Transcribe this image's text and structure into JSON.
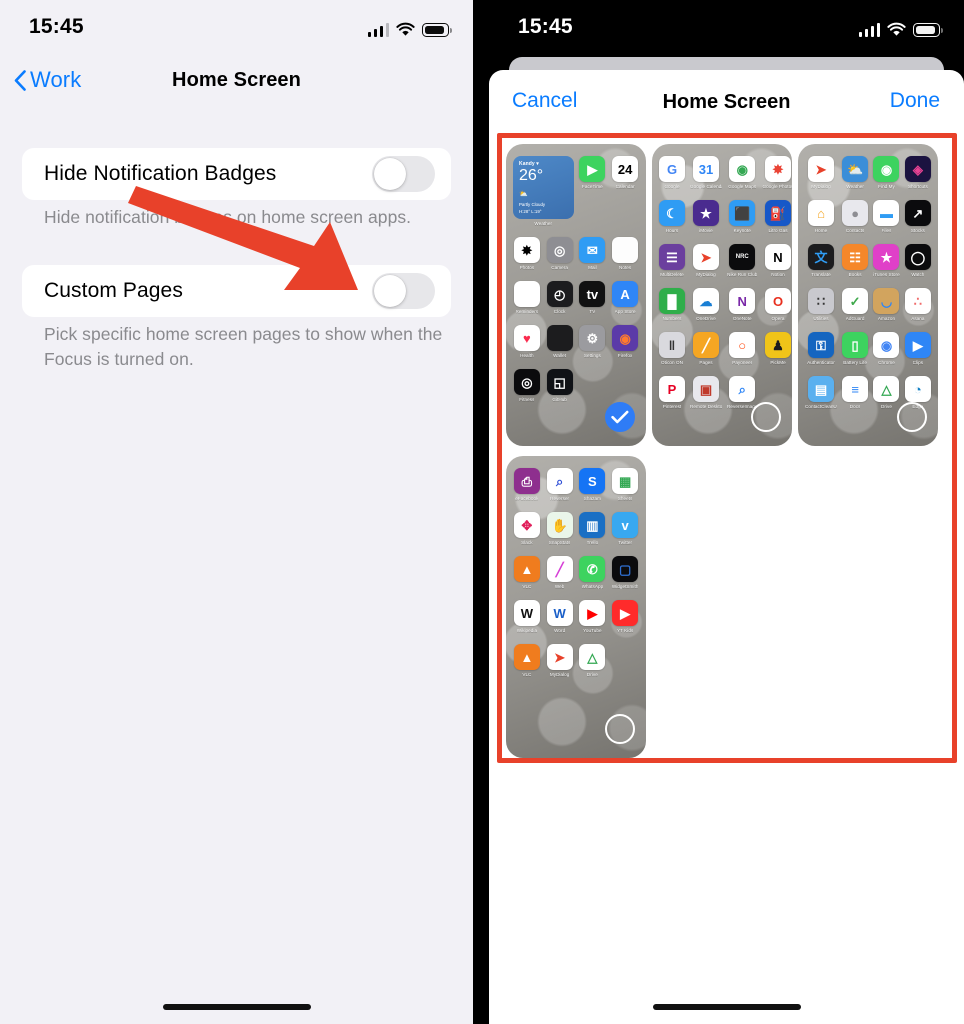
{
  "left": {
    "status": {
      "time": "15:45",
      "signal_icon": "cellular-bars-icon",
      "wifi_icon": "wifi-icon",
      "battery_icon": "battery-icon"
    },
    "nav": {
      "back_label": "Work",
      "back_icon": "chevron-left-icon",
      "title": "Home Screen"
    },
    "rows": [
      {
        "label": "Hide Notification Badges",
        "toggle_state": "off",
        "footnote": "Hide notification badges on home screen apps."
      },
      {
        "label": "Custom Pages",
        "toggle_state": "off",
        "footnote": "Pick specific home screen pages to show when the Focus is turned on."
      }
    ],
    "annotation": {
      "type": "arrow",
      "color": "#e8412a",
      "points_to": "custom-pages-toggle"
    }
  },
  "right": {
    "status": {
      "time": "15:45",
      "signal_icon": "cellular-bars-icon",
      "wifi_icon": "wifi-icon",
      "battery_icon": "battery-icon"
    },
    "sheet": {
      "cancel_label": "Cancel",
      "title": "Home Screen",
      "done_label": "Done"
    },
    "annotation": {
      "type": "rectangle",
      "color": "#e8412a"
    },
    "accent_color": "#0a7cff",
    "pages": [
      {
        "selected": true,
        "widget": {
          "city": "Kandy",
          "temp": "26°",
          "condition": "Partly Cloudy",
          "high_low": "H:28° L:19°",
          "caption": "Weather"
        },
        "apps": [
          {
            "name": "FaceTime",
            "icon": "facetime-icon",
            "bg": "#3dd35f",
            "fg": "#ffffff",
            "glyph": "▶"
          },
          {
            "name": "Calendar",
            "icon": "calendar-icon",
            "bg": "#ffffff",
            "fg": "#000000",
            "glyph": "24"
          },
          {
            "name": "Photos",
            "icon": "photos-icon",
            "bg": "#ffffff",
            "fg": "#000000",
            "glyph": "✸"
          },
          {
            "name": "Camera",
            "icon": "camera-icon",
            "bg": "#8e8e93",
            "fg": "#ffffff",
            "glyph": "◎"
          },
          {
            "name": "Mail",
            "icon": "mail-icon",
            "bg": "#2f9cf4",
            "fg": "#ffffff",
            "glyph": "✉"
          },
          {
            "name": "Notes",
            "icon": "notes-icon",
            "bg": "#fdfdfd",
            "fg": "#f0c419",
            "glyph": ""
          },
          {
            "name": "Reminders",
            "icon": "reminders-icon",
            "bg": "#ffffff",
            "fg": "#000000",
            "glyph": ""
          },
          {
            "name": "Clock",
            "icon": "clock-icon",
            "bg": "#1c1c1e",
            "fg": "#ffffff",
            "glyph": "◴"
          },
          {
            "name": "TV",
            "icon": "appletv-icon",
            "bg": "#111111",
            "fg": "#ffffff",
            "glyph": "tv"
          },
          {
            "name": "App Store",
            "icon": "appstore-icon",
            "bg": "#2f86f6",
            "fg": "#ffffff",
            "glyph": "A"
          },
          {
            "name": "Health",
            "icon": "health-icon",
            "bg": "#ffffff",
            "fg": "#fa2b4e",
            "glyph": "♥"
          },
          {
            "name": "Wallet",
            "icon": "wallet-icon",
            "bg": "#1c1c1e",
            "fg": "#ffffff",
            "glyph": ""
          },
          {
            "name": "Settings",
            "icon": "settings-icon",
            "bg": "#9b9b9f",
            "fg": "#ffffff",
            "glyph": "⚙"
          },
          {
            "name": "Firefox",
            "icon": "firefox-icon",
            "bg": "#5b3aa8",
            "fg": "#ff7a2f",
            "glyph": "◉"
          },
          {
            "name": "Fitness",
            "icon": "fitness-icon",
            "bg": "#0b0b0d",
            "fg": "#ffffff",
            "glyph": "◎"
          },
          {
            "name": "GitHub",
            "icon": "github-icon",
            "bg": "#101216",
            "fg": "#ffffff",
            "glyph": "◱"
          }
        ]
      },
      {
        "selected": false,
        "apps": [
          {
            "name": "Google",
            "icon": "google-icon",
            "bg": "#ffffff",
            "fg": "#4285f4",
            "glyph": "G"
          },
          {
            "name": "Google Calendar",
            "icon": "google-calendar-icon",
            "bg": "#ffffff",
            "fg": "#2f86f6",
            "glyph": "31"
          },
          {
            "name": "Google Maps",
            "icon": "google-maps-icon",
            "bg": "#ffffff",
            "fg": "#34a853",
            "glyph": "◉"
          },
          {
            "name": "Google Photos",
            "icon": "google-photos-icon",
            "bg": "#ffffff",
            "fg": "#ea4335",
            "glyph": "✸"
          },
          {
            "name": "Hours",
            "icon": "hours-icon",
            "bg": "#2f9cf4",
            "fg": "#ffffff",
            "glyph": "☾"
          },
          {
            "name": "iMovie",
            "icon": "imovie-icon",
            "bg": "#4a2b8f",
            "fg": "#ffffff",
            "glyph": "★"
          },
          {
            "name": "Keynote",
            "icon": "keynote-icon",
            "bg": "#2f9cf4",
            "fg": "#ffffff",
            "glyph": "⬛"
          },
          {
            "name": "Litro Gas",
            "icon": "litro-gas-icon",
            "bg": "#1758c8",
            "fg": "#ffffff",
            "glyph": "⛽"
          },
          {
            "name": "MultiDelete",
            "icon": "multidelete-icon",
            "bg": "#6b3f9e",
            "fg": "#ffffff",
            "glyph": "☰"
          },
          {
            "name": "MyDialog",
            "icon": "mydialog-icon",
            "bg": "#ffffff",
            "fg": "#e8412a",
            "glyph": "➤"
          },
          {
            "name": "Nike Run Club",
            "icon": "nike-run-club-icon",
            "bg": "#0b0b0d",
            "fg": "#ffffff",
            "glyph": "NRC"
          },
          {
            "name": "Notion",
            "icon": "notion-icon",
            "bg": "#ffffff",
            "fg": "#000000",
            "glyph": "N"
          },
          {
            "name": "Numbers",
            "icon": "numbers-icon",
            "bg": "#2fae4a",
            "fg": "#ffffff",
            "glyph": "█"
          },
          {
            "name": "OneDrive",
            "icon": "onedrive-icon",
            "bg": "#ffffff",
            "fg": "#1a7fd4",
            "glyph": "☁"
          },
          {
            "name": "OneNote",
            "icon": "onenote-icon",
            "bg": "#ffffff",
            "fg": "#7a29a8",
            "glyph": "N"
          },
          {
            "name": "Opera",
            "icon": "opera-icon",
            "bg": "#ffffff",
            "fg": "#e8301f",
            "glyph": "O"
          },
          {
            "name": "Oticon ON",
            "icon": "oticon-on-icon",
            "bg": "#d9d9de",
            "fg": "#333333",
            "glyph": "‖"
          },
          {
            "name": "Pages",
            "icon": "pages-icon",
            "bg": "#f5a623",
            "fg": "#ffffff",
            "glyph": "╱"
          },
          {
            "name": "Payoneer",
            "icon": "payoneer-icon",
            "bg": "#ffffff",
            "fg": "#ff4b12",
            "glyph": "○"
          },
          {
            "name": "PickMe",
            "icon": "pickme-icon",
            "bg": "#f0c419",
            "fg": "#1c1c1e",
            "glyph": "♟"
          },
          {
            "name": "Pinterest",
            "icon": "pinterest-icon",
            "bg": "#ffffff",
            "fg": "#e60023",
            "glyph": "P"
          },
          {
            "name": "Remote Desktop",
            "icon": "remote-desktop-icon",
            "bg": "#e8e8ed",
            "fg": "#c0392b",
            "glyph": "▣"
          },
          {
            "name": "ReverseImage",
            "icon": "reverse-image-icon",
            "bg": "#ffffff",
            "fg": "#2f86f6",
            "glyph": "⌕"
          }
        ]
      },
      {
        "selected": false,
        "apps": [
          {
            "name": "MyDialog",
            "icon": "mydialog-icon",
            "bg": "#ffffff",
            "fg": "#e8412a",
            "glyph": "➤"
          },
          {
            "name": "Weather",
            "icon": "weather-icon",
            "bg": "#3b8ed8",
            "fg": "#ffffff",
            "glyph": "⛅"
          },
          {
            "name": "Find My",
            "icon": "find-my-icon",
            "bg": "#3dd35f",
            "fg": "#ffffff",
            "glyph": "◉"
          },
          {
            "name": "Shortcuts",
            "icon": "shortcuts-icon",
            "bg": "#1b1340",
            "fg": "#e84393",
            "glyph": "◈"
          },
          {
            "name": "Home",
            "icon": "home-icon",
            "bg": "#ffffff",
            "fg": "#f5a623",
            "glyph": "⌂"
          },
          {
            "name": "Contacts",
            "icon": "contacts-icon",
            "bg": "#e8e8ed",
            "fg": "#8e8e93",
            "glyph": "●"
          },
          {
            "name": "Files",
            "icon": "files-icon",
            "bg": "#ffffff",
            "fg": "#2f9cf4",
            "glyph": "▬"
          },
          {
            "name": "Stocks",
            "icon": "stocks-icon",
            "bg": "#0b0b0d",
            "fg": "#ffffff",
            "glyph": "↗"
          },
          {
            "name": "Translate",
            "icon": "translate-icon",
            "bg": "#1c1c1e",
            "fg": "#2f9cf4",
            "glyph": "文"
          },
          {
            "name": "Books",
            "icon": "books-icon",
            "bg": "#f5872a",
            "fg": "#ffffff",
            "glyph": "☷"
          },
          {
            "name": "iTunes Store",
            "icon": "itunes-store-icon",
            "bg": "#e040c8",
            "fg": "#ffffff",
            "glyph": "★"
          },
          {
            "name": "Watch",
            "icon": "watch-icon",
            "bg": "#0b0b0d",
            "fg": "#ffffff",
            "glyph": "◯"
          },
          {
            "name": "Utilities",
            "icon": "utilities-folder-icon",
            "bg": "#c9c9ce",
            "fg": "#333333",
            "glyph": "∷"
          },
          {
            "name": "AdGuard",
            "icon": "adguard-icon",
            "bg": "#ffffff",
            "fg": "#3fa94c",
            "glyph": "✓"
          },
          {
            "name": "Amazon",
            "icon": "amazon-icon",
            "bg": "#d2a45e",
            "fg": "#2f86f6",
            "glyph": "◡"
          },
          {
            "name": "Asana",
            "icon": "asana-icon",
            "bg": "#ffffff",
            "fg": "#f06a6a",
            "glyph": "∴"
          },
          {
            "name": "Authenticator",
            "icon": "authenticator-icon",
            "bg": "#1565c0",
            "fg": "#ffffff",
            "glyph": "⚿"
          },
          {
            "name": "Battery Life",
            "icon": "battery-life-icon",
            "bg": "#3dd35f",
            "fg": "#ffffff",
            "glyph": "▯"
          },
          {
            "name": "Chrome",
            "icon": "chrome-icon",
            "bg": "#ffffff",
            "fg": "#4285f4",
            "glyph": "◉"
          },
          {
            "name": "Clips",
            "icon": "clips-icon",
            "bg": "#2f86f6",
            "fg": "#ffffff",
            "glyph": "▶"
          },
          {
            "name": "ContactCleanUp",
            "icon": "contact-cleanup-icon",
            "bg": "#5ab0ef",
            "fg": "#ffffff",
            "glyph": "▤"
          },
          {
            "name": "Docs",
            "icon": "docs-icon",
            "bg": "#ffffff",
            "fg": "#2f86f6",
            "glyph": "≡"
          },
          {
            "name": "Drive",
            "icon": "drive-icon",
            "bg": "#ffffff",
            "fg": "#34a853",
            "glyph": "△"
          },
          {
            "name": "Edge",
            "icon": "edge-icon",
            "bg": "#ffffff",
            "fg": "#0f7ec4",
            "glyph": "◔"
          }
        ]
      },
      {
        "selected": false,
        "apps": [
          {
            "name": "eFacebook",
            "icon": "efacebook-icon",
            "bg": "#8e2f8e",
            "fg": "#ffffff",
            "glyph": "⎙"
          },
          {
            "name": "Reverser",
            "icon": "reverser-icon",
            "bg": "#ffffff",
            "fg": "#2f4fd6",
            "glyph": "⌕"
          },
          {
            "name": "Shazam",
            "icon": "shazam-icon",
            "bg": "#1574f5",
            "fg": "#ffffff",
            "glyph": "S"
          },
          {
            "name": "Sheets",
            "icon": "sheets-icon",
            "bg": "#ffffff",
            "fg": "#34a853",
            "glyph": "▦"
          },
          {
            "name": "Slack",
            "icon": "slack-icon",
            "bg": "#ffffff",
            "fg": "#e01e5a",
            "glyph": "✥"
          },
          {
            "name": "SnapStats",
            "icon": "snapstats-icon",
            "bg": "#eaf6ea",
            "fg": "#2fae4a",
            "glyph": "✋"
          },
          {
            "name": "Trello",
            "icon": "trello-icon",
            "bg": "#1a6fc4",
            "fg": "#ffffff",
            "glyph": "▥"
          },
          {
            "name": "Twitter",
            "icon": "twitter-icon",
            "bg": "#38a8f0",
            "fg": "#ffffff",
            "glyph": "ᴠ"
          },
          {
            "name": "VLC",
            "icon": "vlc-icon",
            "bg": "#f07c1e",
            "fg": "#ffffff",
            "glyph": "▲"
          },
          {
            "name": "Web",
            "icon": "web-icon",
            "bg": "#ffffff",
            "fg": "#d63fd6",
            "glyph": "╱"
          },
          {
            "name": "WhatsApp",
            "icon": "whatsapp-icon",
            "bg": "#3dd35f",
            "fg": "#ffffff",
            "glyph": "✆"
          },
          {
            "name": "WidgetSmith",
            "icon": "widgetsmith-icon",
            "bg": "#0b0b0d",
            "fg": "#2f6fd0",
            "glyph": "▢"
          },
          {
            "name": "Wikipedia",
            "icon": "wikipedia-icon",
            "bg": "#ffffff",
            "fg": "#111111",
            "glyph": "W"
          },
          {
            "name": "Word",
            "icon": "word-icon",
            "bg": "#ffffff",
            "fg": "#1a5fc8",
            "glyph": "W"
          },
          {
            "name": "YouTube",
            "icon": "youtube-icon",
            "bg": "#ffffff",
            "fg": "#ff0000",
            "glyph": "▶"
          },
          {
            "name": "YT Kids",
            "icon": "youtube-kids-icon",
            "bg": "#ff2b2b",
            "fg": "#ffffff",
            "glyph": "▶"
          },
          {
            "name": "VLC",
            "icon": "vlc-icon",
            "bg": "#f07c1e",
            "fg": "#ffffff",
            "glyph": "▲"
          },
          {
            "name": "MyDialog",
            "icon": "mydialog-icon",
            "bg": "#ffffff",
            "fg": "#e8412a",
            "glyph": "➤"
          },
          {
            "name": "Drive",
            "icon": "drive-icon",
            "bg": "#ffffff",
            "fg": "#34a853",
            "glyph": "△"
          }
        ]
      }
    ]
  }
}
